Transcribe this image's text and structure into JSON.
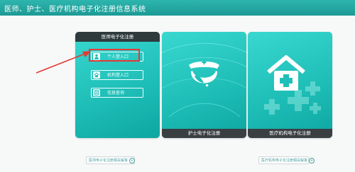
{
  "app": {
    "title": "医师、护士、医疗机构电子化注册信息系统"
  },
  "cards": [
    {
      "header": "医师电子化注册"
    },
    {
      "footer": "护士电子化注册"
    },
    {
      "footer": "医疗机构电子化注册"
    }
  ],
  "doctor_buttons": [
    {
      "label": "个人登入口",
      "icon": "person-icon"
    },
    {
      "label": "机构登入口",
      "icon": "home-icon"
    },
    {
      "label": "信息查询",
      "icon": "document-icon"
    }
  ],
  "links": [
    {
      "label": "医师电子化注册相关解答"
    },
    {
      "label": "医疗机构电子化注册相关解答"
    }
  ],
  "colors": {
    "teal": "#1fbfb8",
    "highlight": "#e53935",
    "arrow": "#e53935"
  }
}
